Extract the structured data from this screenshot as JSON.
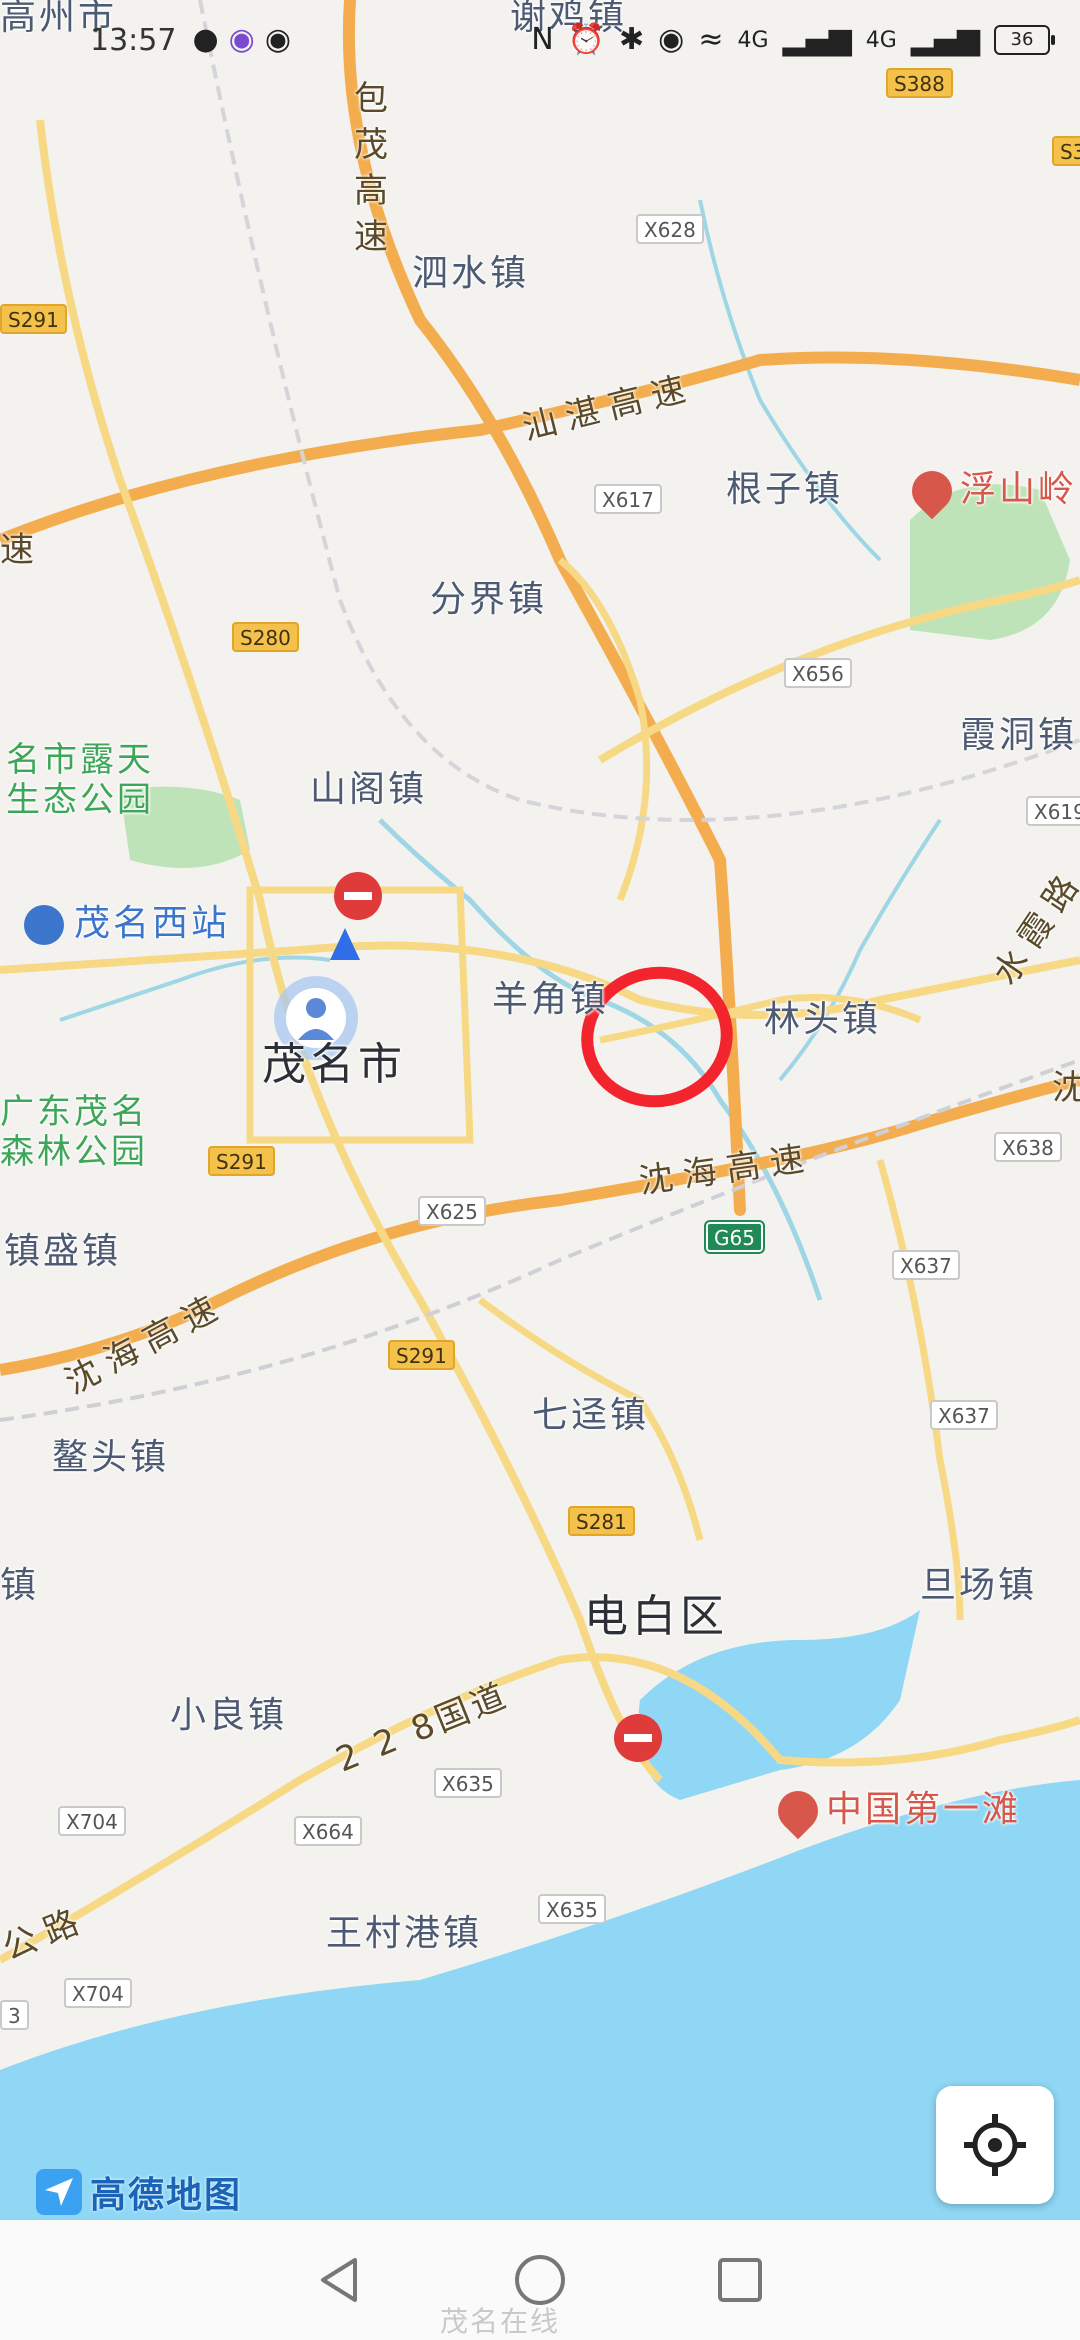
{
  "status_bar": {
    "time": "13:57",
    "left_icons": [
      "wechat-icon",
      "soul-icon",
      "eye-icon"
    ],
    "right_icons": [
      "nfc-icon",
      "alarm-icon",
      "bluetooth-icon",
      "location-icon",
      "wifi-icon",
      "signal-4g-icon",
      "signal-4g-icon-2"
    ],
    "signal_label_1": "4G",
    "signal_label_2": "4G",
    "battery": "36"
  },
  "map": {
    "places": {
      "gaozhou": "高州市",
      "xiexiang": "谢鸡镇",
      "sishui": "泗水镇",
      "genzi": "根子镇",
      "fushanling": "浮山岭",
      "fenjie": "分界镇",
      "xiadong": "霞洞镇",
      "shange": "山阁镇",
      "maoming_park": "名市露天\n生态公园",
      "maoming_west": "茂名西站",
      "maoming": "茂名市",
      "yangjiao": "羊角镇",
      "lintou": "林头镇",
      "gd_forest_park": "广东茂名\n森林公园",
      "shengzhen": "镇盛镇",
      "qijing": "七迳镇",
      "aotou": "鳌头镇",
      "zhen_left": "镇",
      "dianbai": "电白区",
      "danchang": "旦场镇",
      "xiaoliang": "小良镇",
      "first_beach": "中国第一滩",
      "wangcungang": "王村港镇"
    },
    "highways": {
      "baomao": "包茂高速",
      "shanzhan": "汕湛高速",
      "su_left": "速",
      "shenhai_1": "沈海高速",
      "shenhai_2": "沈海高速",
      "shuixia": "水霞路",
      "shen_right": "沈",
      "g228": "2 2 8国道",
      "gonglu": "公路"
    },
    "road_badges": {
      "s388": "S388",
      "s3": "S3",
      "x628": "X628",
      "s291_a": "S291",
      "x617": "X617",
      "s280": "S280",
      "x656": "X656",
      "x619": "X619",
      "s291_b": "S291",
      "x625": "X625",
      "x638": "X638",
      "g65": "G65",
      "x637_a": "X637",
      "s291_c": "S291",
      "x637_b": "X637",
      "s281": "S281",
      "x635_a": "X635",
      "x704_a": "X704",
      "x664": "X664",
      "x635_b": "X635",
      "x704_b": "X704",
      "n3": "3"
    },
    "colors": {
      "land": "#f3f2ef",
      "sea": "#8fd7f5",
      "highway": "#f3ad4e",
      "road": "#f7d985",
      "river": "#9fd6e6",
      "park": "#bfe3b8",
      "annotation": "#f2242d"
    }
  },
  "logo": {
    "text": "高德地图"
  },
  "watermark": "茂名在线"
}
